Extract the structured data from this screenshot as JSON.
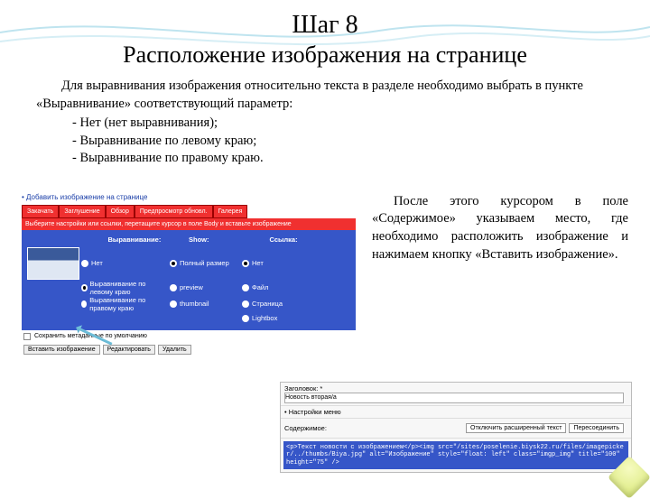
{
  "doc": {
    "step": "Шаг 8",
    "title": "Расположение изображения на странице",
    "intro": "Для выравнивания изображения относительно текста в разделе необходимо выбрать в пункте «Выравнивание» соответствующий параметр:",
    "items": [
      "- Нет (нет выравнивания);",
      "- Выравнивание по левому краю;",
      "- Выравнивание по правому краю."
    ],
    "para2": "После этого курсором в поле «Содержимое» указываем место, где необходимо расположить изображение и нажимаем кнопку «Вставить изображение»."
  },
  "shot1": {
    "link": "• Добавить изображение на странице",
    "tabs": [
      "Закачать",
      "Заглушение",
      "Обзор",
      "Предпросмотр обновл.",
      "Галерея"
    ],
    "hint": "Выберите настройки или ссылки, перетащите курсор в поле Body и вставьте изображение",
    "heads": [
      "",
      "Выравнивание:",
      "Show:",
      "Ссылка:"
    ],
    "thumb_label": "",
    "rows": [
      {
        "align": "Нет",
        "show": "Полный размер",
        "link": "Нет",
        "alignSel": false,
        "showSel": true,
        "linkSel": true
      },
      {
        "align": "Выравнивание по левому краю",
        "show": "preview",
        "link": "Файл",
        "alignSel": true,
        "showSel": false,
        "linkSel": false
      },
      {
        "align": "Выравнивание по правому краю",
        "show": "thumbnail",
        "link": "Страница",
        "alignSel": false,
        "showSel": false,
        "linkSel": false
      },
      {
        "align": "",
        "show": "",
        "link": "Lightbox",
        "alignSel": false,
        "showSel": false,
        "linkSel": false
      }
    ],
    "chk_label": "Сохранить метаданные по умолчанию",
    "buttons": [
      "Вставить изображение",
      "Редактировать",
      "Удалить"
    ]
  },
  "shot2": {
    "label_title": "Заголовок: *",
    "title_value": "Новость вторая/a",
    "label_menu": "• Настройки меню",
    "label_body": "Содержимое:",
    "tabs": [
      "Отключить расширенный текст",
      "Пересоединить"
    ],
    "code": "<p>Текст новости с изображением</p><img src=\"/sites/poselenie.biysk22.ru/files/imagepicker/../thumbs/Biya.jpg\" alt=\"Изображение\" style=\"float: left\" class=\"imgp_img\" title=\"100\" height=\"75\" />"
  }
}
